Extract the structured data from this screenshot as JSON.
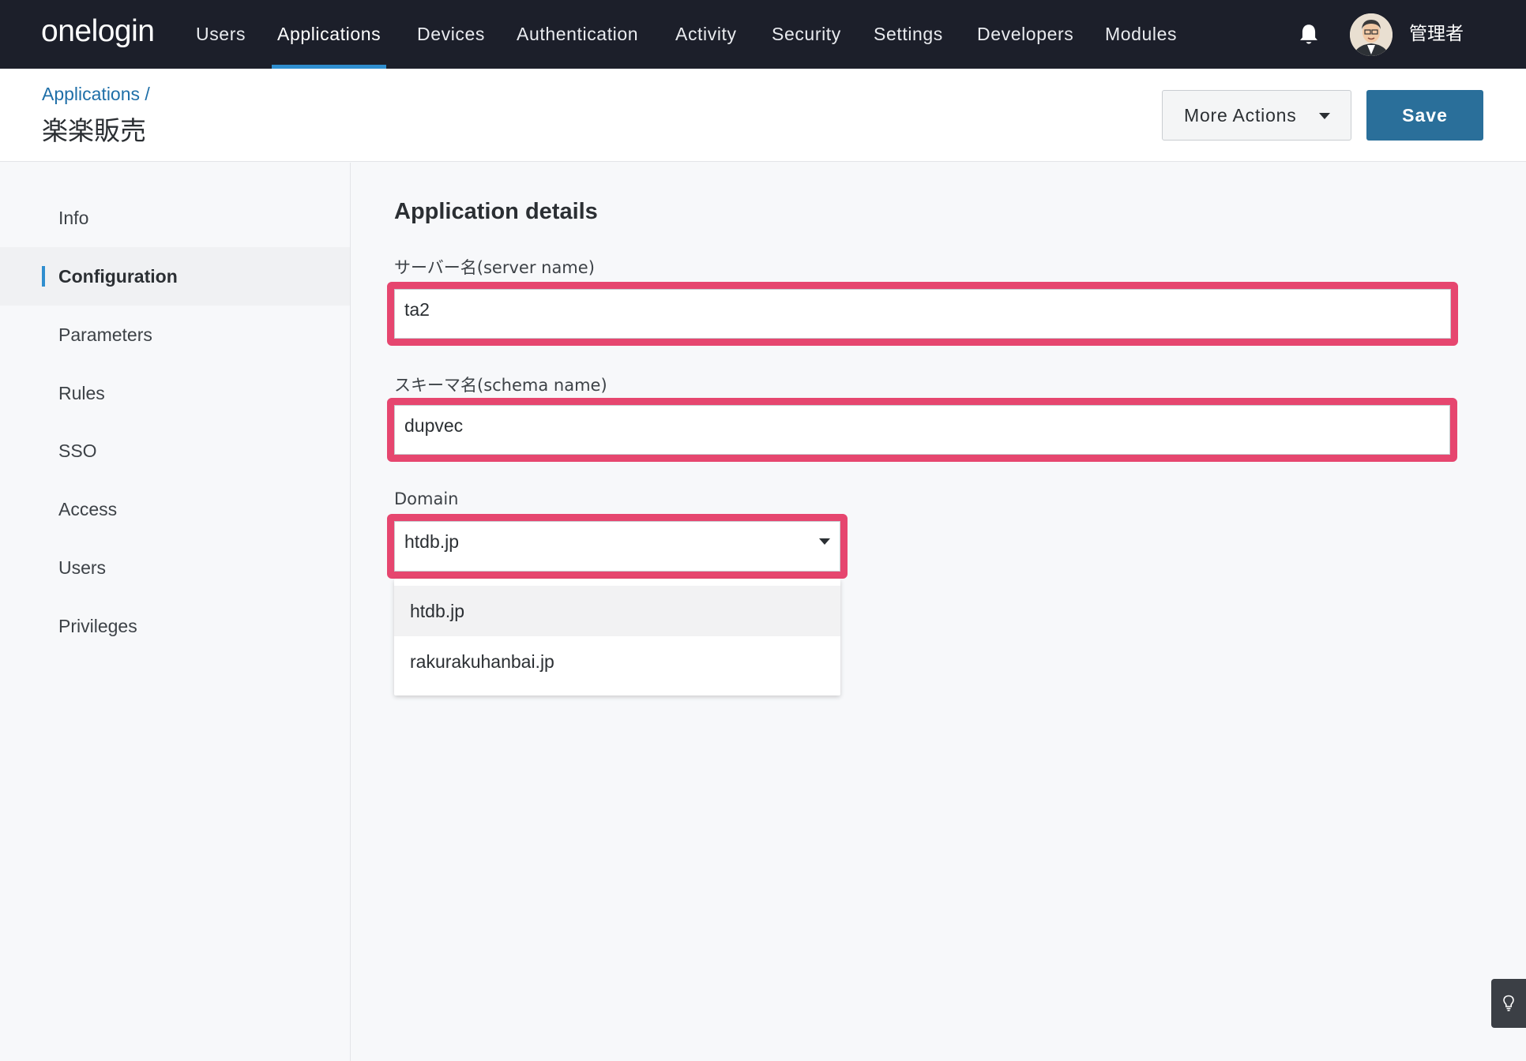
{
  "nav": {
    "logo": "onelogin",
    "items": [
      {
        "label": "Users"
      },
      {
        "label": "Applications",
        "active": true
      },
      {
        "label": "Devices"
      },
      {
        "label": "Authentication"
      },
      {
        "label": "Activity"
      },
      {
        "label": "Security"
      },
      {
        "label": "Settings"
      },
      {
        "label": "Developers"
      },
      {
        "label": "Modules"
      }
    ],
    "user_name": "管理者"
  },
  "header": {
    "breadcrumb": "Applications /",
    "title": "楽楽販売",
    "more_actions_label": "More Actions",
    "save_label": "Save"
  },
  "sidebar": {
    "items": [
      {
        "label": "Info"
      },
      {
        "label": "Configuration",
        "active": true
      },
      {
        "label": "Parameters"
      },
      {
        "label": "Rules"
      },
      {
        "label": "SSO"
      },
      {
        "label": "Access"
      },
      {
        "label": "Users"
      },
      {
        "label": "Privileges"
      }
    ]
  },
  "main": {
    "section_title": "Application details",
    "server_name": {
      "label": "サーバー名(server name)",
      "value": "ta2"
    },
    "schema_name": {
      "label": "スキーマ名(schema name)",
      "value": "dupvec"
    },
    "domain": {
      "label": "Domain",
      "value": "htdb.jp",
      "options": [
        "htdb.jp",
        "rakurakuhanbai.jp"
      ]
    }
  },
  "colors": {
    "nav_bg": "#1c1f2a",
    "accent": "#2f8ecf",
    "save_button": "#2a6f9a",
    "highlight": "#e6466f"
  },
  "icons": [
    "bell-icon",
    "avatar",
    "caret-down-icon",
    "lightbulb-icon"
  ]
}
